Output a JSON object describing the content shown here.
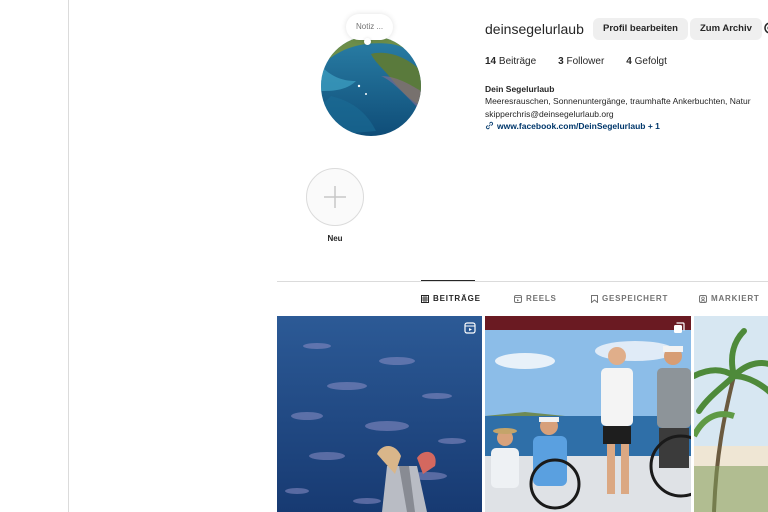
{
  "note": {
    "text": "Notiz ..."
  },
  "profile": {
    "username": "deinsegelurlaub",
    "edit_button": "Profil bearbeiten",
    "archive_button": "Zum Archiv"
  },
  "stats": [
    {
      "count": "14",
      "label": "Beiträge"
    },
    {
      "count": "3",
      "label": "Follower"
    },
    {
      "count": "4",
      "label": "Gefolgt"
    }
  ],
  "bio": {
    "name": "Dein Segelurlaub",
    "line1": "Meeresrauschen, Sonnenuntergänge, traumhafte Ankerbuchten, Natur",
    "email": "skipperchris@deinsegelurlaub.org",
    "link": "www.facebook.com/DeinSegelurlaub + 1"
  },
  "highlight": {
    "label": "Neu"
  },
  "tabs": [
    {
      "label": "BEITRÄGE",
      "icon": "grid-icon",
      "active": true
    },
    {
      "label": "REELS",
      "icon": "reels-icon",
      "active": false
    },
    {
      "label": "GESPEICHERT",
      "icon": "bookmark-icon",
      "active": false
    },
    {
      "label": "MARKIERT",
      "icon": "tagged-icon",
      "active": false
    }
  ],
  "posts": [
    {
      "type": "reel",
      "icon": "reel-badge-icon"
    },
    {
      "type": "carousel",
      "icon": "carousel-badge-icon"
    },
    {
      "type": "image"
    }
  ],
  "colors": {
    "link": "#00376b",
    "button_bg": "#efefef",
    "border": "#dbdbdb",
    "muted": "#737373"
  }
}
